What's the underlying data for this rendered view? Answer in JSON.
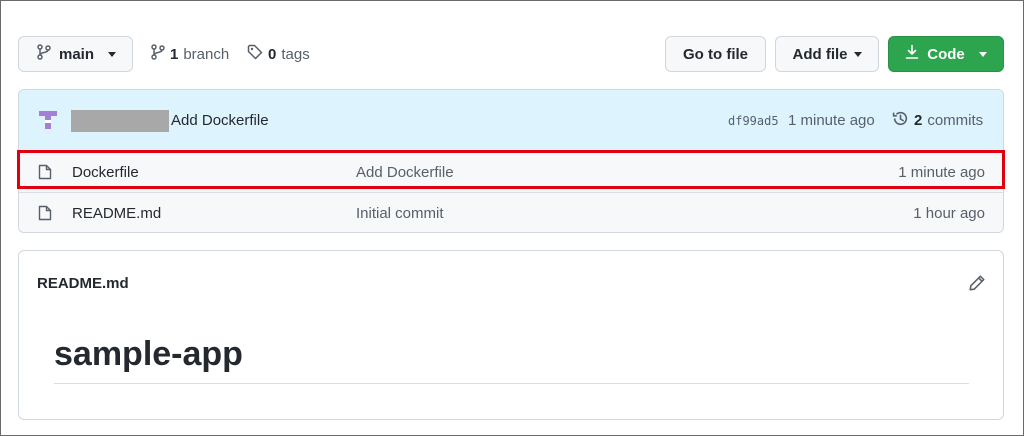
{
  "toolbar": {
    "branch_label": "main",
    "branch_count": "1",
    "branch_text": "branch",
    "tags_count": "0",
    "tags_text": "tags",
    "goto_label": "Go to file",
    "addfile_label": "Add file",
    "code_label": "Code"
  },
  "latest_commit": {
    "message": "Add Dockerfile",
    "sha": "df99ad5",
    "time": "1 minute ago",
    "commits_count": "2",
    "commits_text": "commits"
  },
  "files": [
    {
      "name": "Dockerfile",
      "commit": "Add Dockerfile",
      "time": "1 minute ago"
    },
    {
      "name": "README.md",
      "commit": "Initial commit",
      "time": "1 hour ago"
    }
  ],
  "readme": {
    "title": "README.md",
    "heading": "sample-app"
  },
  "colors": {
    "accent_green": "#2da44e",
    "commit_bg": "#ddf4ff",
    "highlight": "#e0000f"
  },
  "icons": [
    "git-branch-icon",
    "tag-icon",
    "download-icon",
    "history-icon",
    "file-icon",
    "pencil-icon",
    "avatar-icon"
  ]
}
